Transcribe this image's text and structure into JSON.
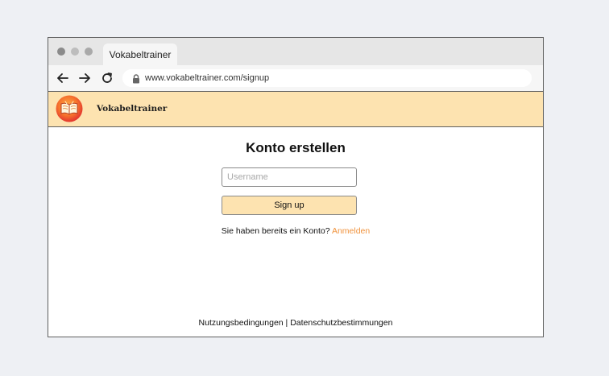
{
  "browser": {
    "tab_title": "Vokabeltrainer",
    "url": "www.vokabeltrainer.com/signup",
    "icons": [
      "back-arrow-icon",
      "forward-arrow-icon",
      "reload-icon",
      "lock-icon"
    ]
  },
  "header": {
    "brand": "Vokabeltrainer",
    "logo_icon": "open-book-icon",
    "background": "#fde3b0"
  },
  "form": {
    "title": "Konto erstellen",
    "username_placeholder": "Username",
    "username_value": "",
    "signup_label": "Sign up",
    "have_account_text": "Sie haben bereits ein Konto?",
    "login_link_label": "Anmelden"
  },
  "footer": {
    "terms_label": "Nutzungsbedingungen",
    "separator": "|",
    "privacy_label": "Datenschutzbestimmungen"
  },
  "colors": {
    "accent": "#f0923c",
    "button_bg": "#fde3b0",
    "page_bg": "#eef0f4"
  }
}
